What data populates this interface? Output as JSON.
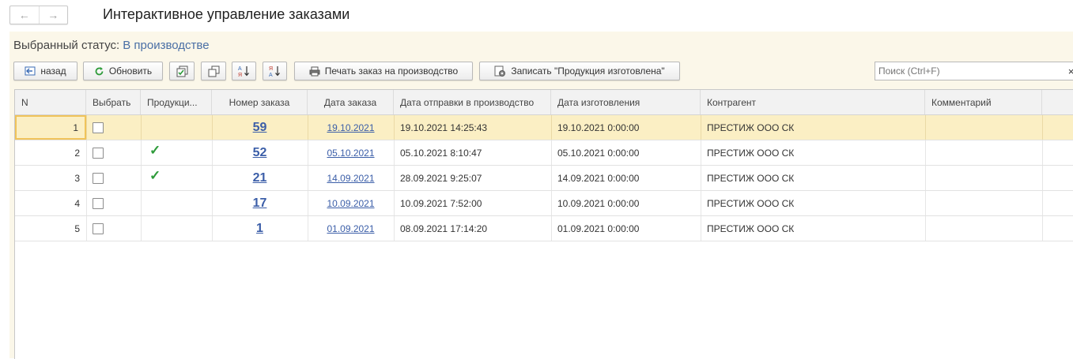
{
  "window": {
    "title": "Интерактивное управление заказами",
    "back_icon": "arrow-left-icon",
    "forward_icon": "arrow-right-icon"
  },
  "status": {
    "label": "Выбранный статус:",
    "value": "В производстве"
  },
  "toolbar": {
    "back_label": "назад",
    "refresh_label": "Обновить",
    "print_label": "Печать заказ на производство",
    "record_label": "Записать \"Продукция изготовлена\"",
    "search_placeholder": "Поиск (Ctrl+F)",
    "search_clear": "×"
  },
  "table": {
    "headers": [
      "N",
      "Выбрать",
      "Продукци...",
      "Номер заказа",
      "Дата заказа",
      "Дата отправки в производство",
      "Дата изготовления",
      "Контрагент",
      "Комментарий"
    ],
    "rows": [
      {
        "n": "1",
        "selected": false,
        "produced": false,
        "order": "59",
        "order_date": "19.10.2021",
        "sent": "19.10.2021 14:25:43",
        "made": "19.10.2021 0:00:00",
        "contractor": "ПРЕСТИЖ ООО СК",
        "comment": ""
      },
      {
        "n": "2",
        "selected": false,
        "produced": true,
        "order": "52",
        "order_date": "05.10.2021",
        "sent": "05.10.2021 8:10:47",
        "made": "05.10.2021 0:00:00",
        "contractor": "ПРЕСТИЖ ООО СК",
        "comment": ""
      },
      {
        "n": "3",
        "selected": false,
        "produced": true,
        "order": "21",
        "order_date": "14.09.2021",
        "sent": "28.09.2021 9:25:07",
        "made": "14.09.2021 0:00:00",
        "contractor": "ПРЕСТИЖ ООО СК",
        "comment": ""
      },
      {
        "n": "4",
        "selected": false,
        "produced": false,
        "order": "17",
        "order_date": "10.09.2021",
        "sent": "10.09.2021 7:52:00",
        "made": "10.09.2021 0:00:00",
        "contractor": "ПРЕСТИЖ ООО СК",
        "comment": ""
      },
      {
        "n": "5",
        "selected": false,
        "produced": false,
        "order": "1",
        "order_date": "01.09.2021",
        "sent": "08.09.2021 17:14:20",
        "made": "01.09.2021 0:00:00",
        "contractor": "ПРЕСТИЖ ООО СК",
        "comment": ""
      }
    ],
    "tick_glyph": "✓"
  },
  "colors": {
    "form_bg": "#fbf7e9",
    "selected_row": "#fbefc4",
    "link": "#3b5ea8",
    "check": "#2e9b3a"
  }
}
